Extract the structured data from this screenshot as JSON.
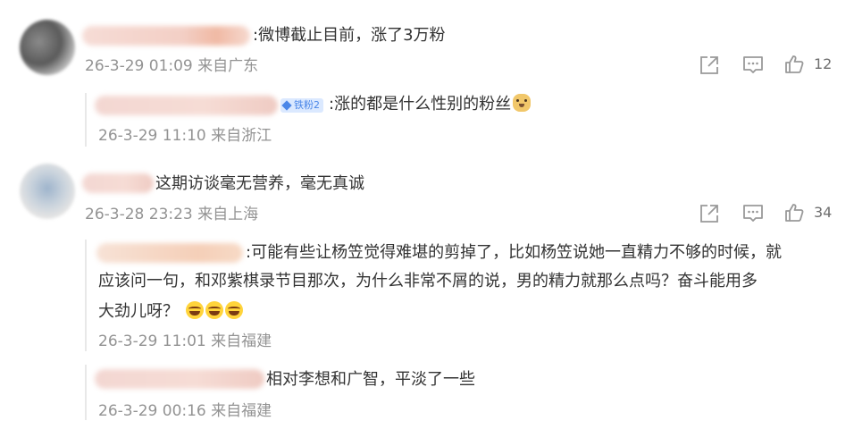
{
  "comments": [
    {
      "text": ":微博截止目前，涨了3万粉",
      "meta": "26-3-29 01:09 来自广东",
      "like_count": "12",
      "replies": [
        {
          "badge": "铁粉2",
          "text": ":涨的都是什么性别的粉丝",
          "emoji": "doge-icon",
          "meta": "26-3-29 11:10 来自浙江"
        }
      ]
    },
    {
      "text": "这期访谈毫无营养，毫无真诚",
      "meta": "26-3-28 23:23 来自上海",
      "like_count": "34",
      "replies": [
        {
          "lines": [
            ":可能有些让杨笠觉得难堪的剪掉了，比如杨笠说她一直精力不够的时候，就",
            "应该问一句，和邓紫棋录节目那次，为什么非常不屑的说，男的精力就那么点吗？奋斗能用多",
            "大劲儿呀？"
          ],
          "emoji": "laugh-cry-icon",
          "meta": "26-3-29 11:01 来自福建"
        },
        {
          "text": "相对李想和广智，平淡了一些",
          "meta": "26-3-29 00:16 来自福建"
        }
      ]
    }
  ],
  "colors": {
    "text": "#333333",
    "meta": "#939393",
    "badge_bg": "#dbe9ff",
    "badge_fg": "#4a86e8"
  }
}
